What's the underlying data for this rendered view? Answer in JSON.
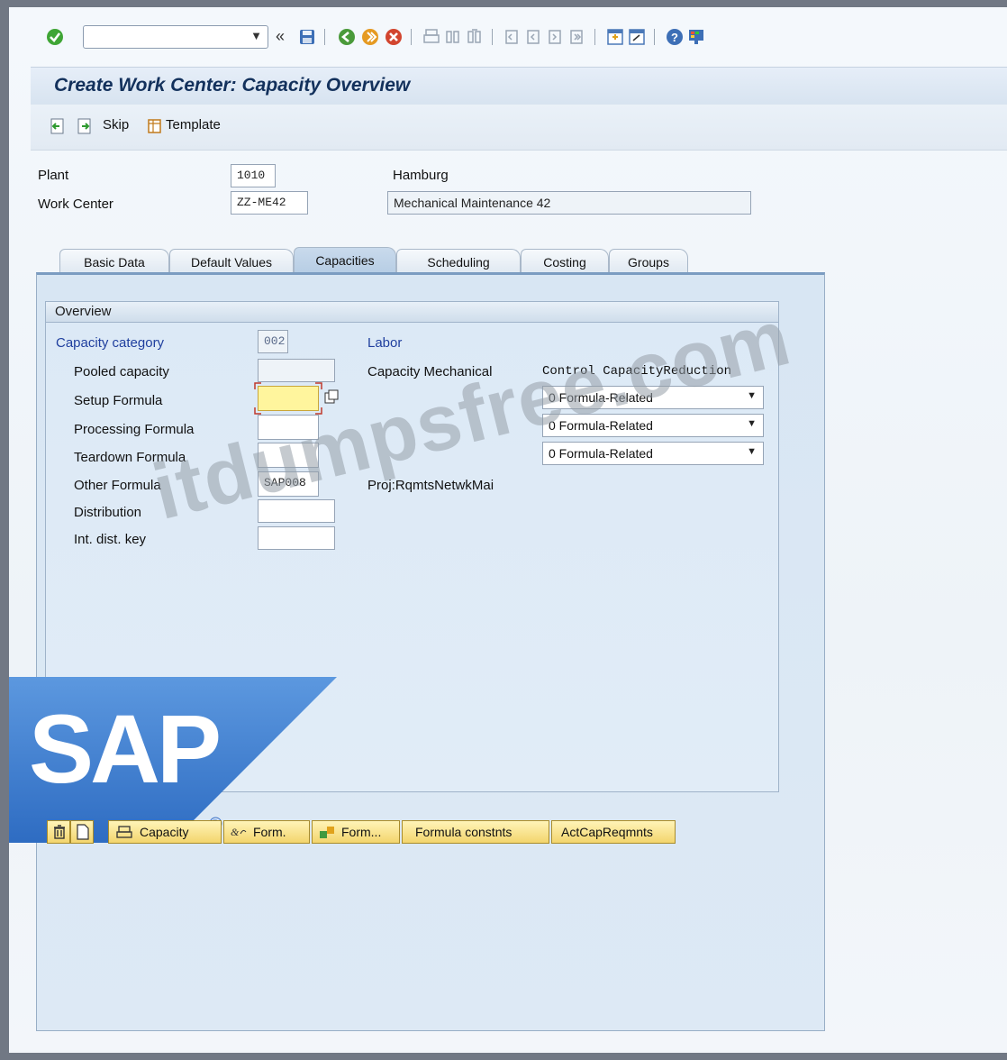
{
  "toolbar": {
    "command_field_value": "",
    "nav_back_glyph": "«"
  },
  "page": {
    "title": "Create Work Center: Capacity Overview"
  },
  "app_toolbar": {
    "skip_label": "Skip",
    "template_label": "Template"
  },
  "header": {
    "plant_label": "Plant",
    "plant_value": "1010",
    "plant_desc": "Hamburg",
    "work_center_label": "Work Center",
    "work_center_value": "ZZ-ME42",
    "work_center_desc": "Mechanical Maintenance 42"
  },
  "tabs": [
    {
      "label": "Basic Data"
    },
    {
      "label": "Default Values"
    },
    {
      "label": "Capacities"
    },
    {
      "label": "Scheduling"
    },
    {
      "label": "Costing"
    },
    {
      "label": "Groups"
    }
  ],
  "active_tab": "Capacities",
  "overview": {
    "title": "Overview",
    "capacity_category_label": "Capacity category",
    "capacity_category_value": "002",
    "capacity_category_desc": "Labor",
    "pooled_capacity_label": "Pooled capacity",
    "pooled_capacity_value": "",
    "capacity_name": "Capacity Mechanical",
    "control_header": "Control CapacityReduction",
    "setup_formula_label": "Setup Formula",
    "setup_formula_value": "",
    "processing_formula_label": "Processing Formula",
    "processing_formula_value": "",
    "teardown_formula_label": "Teardown Formula",
    "teardown_formula_value": "",
    "other_formula_label": "Other Formula",
    "other_formula_value": "SAP008",
    "other_formula_desc": "Proj:RqmtsNetwkMai",
    "distribution_label": "Distribution",
    "distribution_value": "",
    "int_dist_key_label": "Int. dist. key",
    "int_dist_key_value": "",
    "reduction_setup": "0 Formula-Related",
    "reduction_processing": "0 Formula-Related",
    "reduction_teardown": "0 Formula-Related"
  },
  "bottom_buttons": {
    "capacity": "Capacity",
    "form1": "Form.",
    "form2": "Form...",
    "formula_constants": "Formula constnts",
    "act_cap_reqmnts": "ActCapReqmnts"
  },
  "watermark": {
    "text": "itdumpsfree.com",
    "logo_text": "SAP",
    "registered": "®"
  },
  "colors": {
    "title_text": "#13315c",
    "field_highlight": "#fff59d",
    "button_yellow": "#f3d56d",
    "sap_blue": "#3a78cc"
  }
}
